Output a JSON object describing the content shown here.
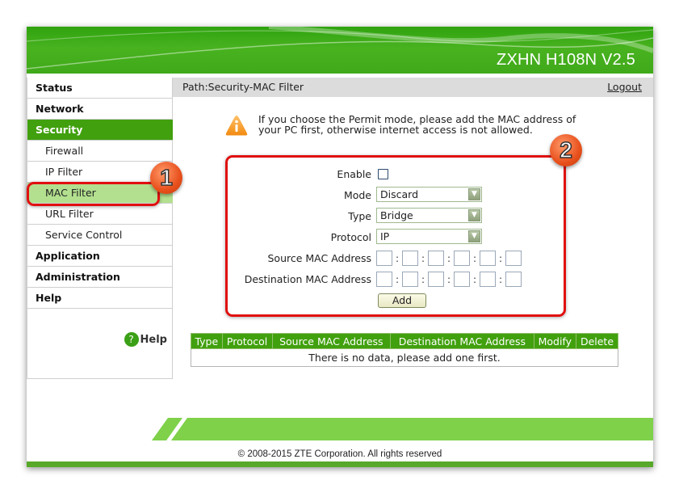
{
  "header": {
    "product_title": "ZXHN H108N V2.5"
  },
  "sidebar": {
    "items": [
      {
        "label": "Status",
        "level": "top",
        "state": "normal"
      },
      {
        "label": "Network",
        "level": "top",
        "state": "normal"
      },
      {
        "label": "Security",
        "level": "top",
        "state": "active"
      },
      {
        "label": "Firewall",
        "level": "sub",
        "state": "normal"
      },
      {
        "label": "IP Filter",
        "level": "sub",
        "state": "normal"
      },
      {
        "label": "MAC Filter",
        "level": "sub",
        "state": "selected"
      },
      {
        "label": "URL Filter",
        "level": "sub",
        "state": "normal"
      },
      {
        "label": "Service Control",
        "level": "sub",
        "state": "normal"
      },
      {
        "label": "Application",
        "level": "top",
        "state": "normal"
      },
      {
        "label": "Administration",
        "level": "top",
        "state": "normal"
      },
      {
        "label": "Help",
        "level": "top",
        "state": "normal"
      }
    ],
    "help_icon_glyph": "?",
    "help_label": "Help"
  },
  "pathbar": {
    "path": "Path:Security-MAC Filter",
    "logout": "Logout"
  },
  "warning": {
    "icon": "warning-icon",
    "text": "If you choose the Permit mode, please add the MAC address of your PC first, otherwise internet access is not allowed."
  },
  "form": {
    "enable_label": "Enable",
    "enable_checked": false,
    "mode_label": "Mode",
    "mode_value": "Discard",
    "type_label": "Type",
    "type_value": "Bridge",
    "protocol_label": "Protocol",
    "protocol_value": "IP",
    "source_mac_label": "Source MAC Address",
    "destination_mac_label": "Destination MAC Address",
    "mac_separator": ":",
    "source_mac_values": [
      "",
      "",
      "",
      "",
      "",
      ""
    ],
    "destination_mac_values": [
      "",
      "",
      "",
      "",
      "",
      ""
    ],
    "add_button": "Add",
    "dropdown_arrow": "▼"
  },
  "annotations": {
    "badge_1": "1",
    "badge_2": "2",
    "highlight_color": "#e01010"
  },
  "table": {
    "headers": [
      "Type",
      "Protocol",
      "Source MAC Address",
      "Destination MAC Address",
      "Modify",
      "Delete"
    ],
    "empty_message": "There is no data, please add one first."
  },
  "footer": {
    "copyright": "© 2008-2015 ZTE Corporation. All rights reserved"
  },
  "colors": {
    "brand_green": "#41a00e",
    "selected_green": "#b3e08f",
    "footer_green": "#7fd14a"
  }
}
